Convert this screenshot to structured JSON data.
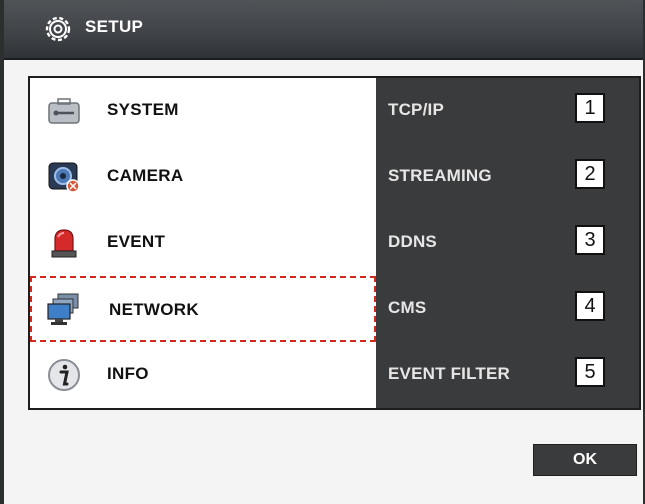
{
  "window": {
    "title": "SETUP"
  },
  "menu": {
    "items": [
      {
        "label": "SYSTEM",
        "icon": "toolbox-icon"
      },
      {
        "label": "CAMERA",
        "icon": "camera-icon"
      },
      {
        "label": "EVENT",
        "icon": "alarm-siren-icon"
      },
      {
        "label": "NETWORK",
        "icon": "network-monitors-icon",
        "selected": true
      },
      {
        "label": "INFO",
        "icon": "info-icon"
      }
    ]
  },
  "submenu": {
    "items": [
      {
        "label": "TCP/IP",
        "shortcut": "1"
      },
      {
        "label": "STREAMING",
        "shortcut": "2"
      },
      {
        "label": "DDNS",
        "shortcut": "3"
      },
      {
        "label": "CMS",
        "shortcut": "4"
      },
      {
        "label": "EVENT FILTER",
        "shortcut": "5"
      }
    ]
  },
  "footer": {
    "ok_label": "OK"
  },
  "colors": {
    "accent_selected": "#d42a1e",
    "submenu_bg": "#3a3b3c",
    "titlebar_bg": "#3f4246"
  }
}
